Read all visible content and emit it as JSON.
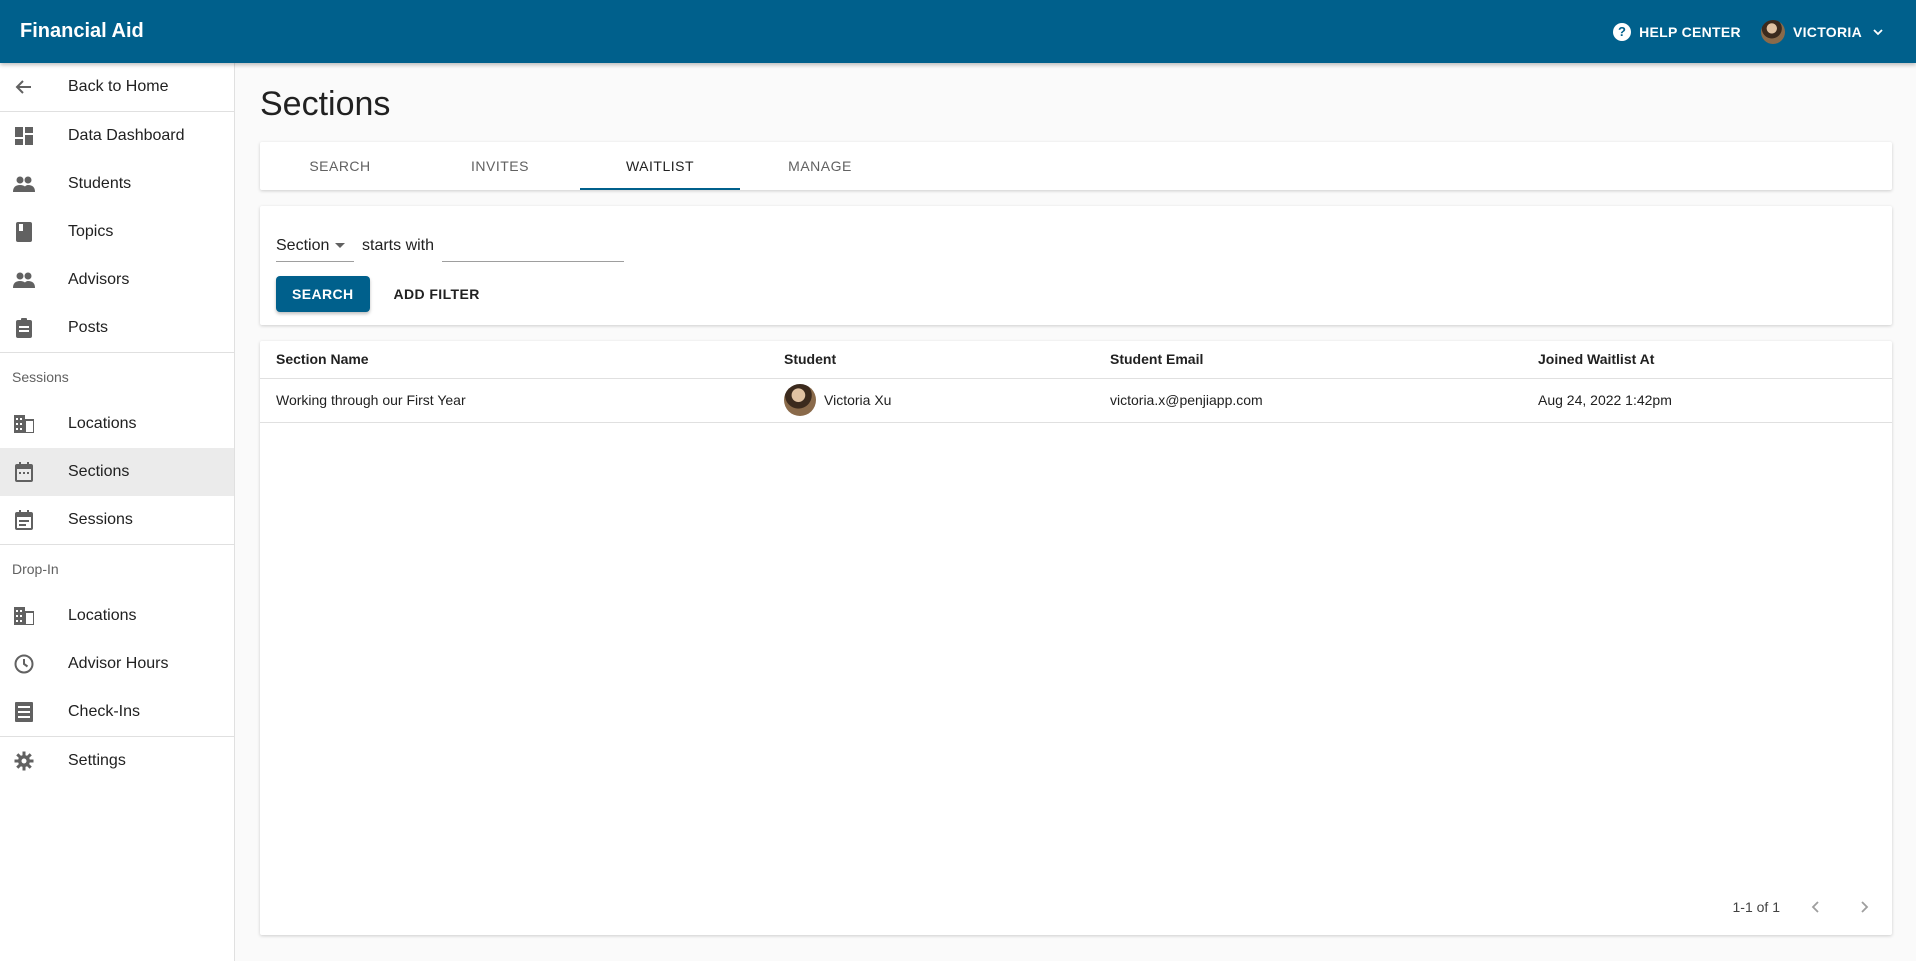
{
  "app": {
    "title": "Financial Aid"
  },
  "header": {
    "help_label": "HELP CENTER",
    "user_name": "VICTORIA"
  },
  "sidebar": {
    "back_label": "Back to Home",
    "items": [
      {
        "label": "Data Dashboard",
        "icon": "dashboard-icon"
      },
      {
        "label": "Students",
        "icon": "people-icon"
      },
      {
        "label": "Topics",
        "icon": "book-icon"
      },
      {
        "label": "Advisors",
        "icon": "people-icon"
      },
      {
        "label": "Posts",
        "icon": "clipboard-icon"
      }
    ],
    "sessions_header": "Sessions",
    "sessions_items": [
      {
        "label": "Locations",
        "icon": "building-icon"
      },
      {
        "label": "Sections",
        "icon": "calendar-icon",
        "active": true
      },
      {
        "label": "Sessions",
        "icon": "calendar-list-icon"
      }
    ],
    "dropin_header": "Drop-In",
    "dropin_items": [
      {
        "label": "Locations",
        "icon": "building-icon"
      },
      {
        "label": "Advisor Hours",
        "icon": "clock-icon"
      },
      {
        "label": "Check-Ins",
        "icon": "list-icon"
      }
    ],
    "settings_label": "Settings"
  },
  "main": {
    "title": "Sections",
    "tabs": [
      {
        "label": "SEARCH"
      },
      {
        "label": "INVITES"
      },
      {
        "label": "WAITLIST",
        "active": true
      },
      {
        "label": "MANAGE"
      }
    ]
  },
  "filter": {
    "field_value": "Section",
    "operator_label": "starts with",
    "input_value": "",
    "search_label": "SEARCH",
    "add_filter_label": "ADD FILTER"
  },
  "table": {
    "columns": [
      "Section Name",
      "Student",
      "Student Email",
      "Joined Waitlist At"
    ],
    "rows": [
      {
        "section_name": "Working through our First Year",
        "student": "Victoria Xu",
        "email": "victoria.x@penjiapp.com",
        "joined": "Aug 24, 2022 1:42pm"
      }
    ],
    "pagination": "1-1 of 1"
  },
  "colors": {
    "primary": "#00608c",
    "active_nav": "#ebebeb"
  }
}
